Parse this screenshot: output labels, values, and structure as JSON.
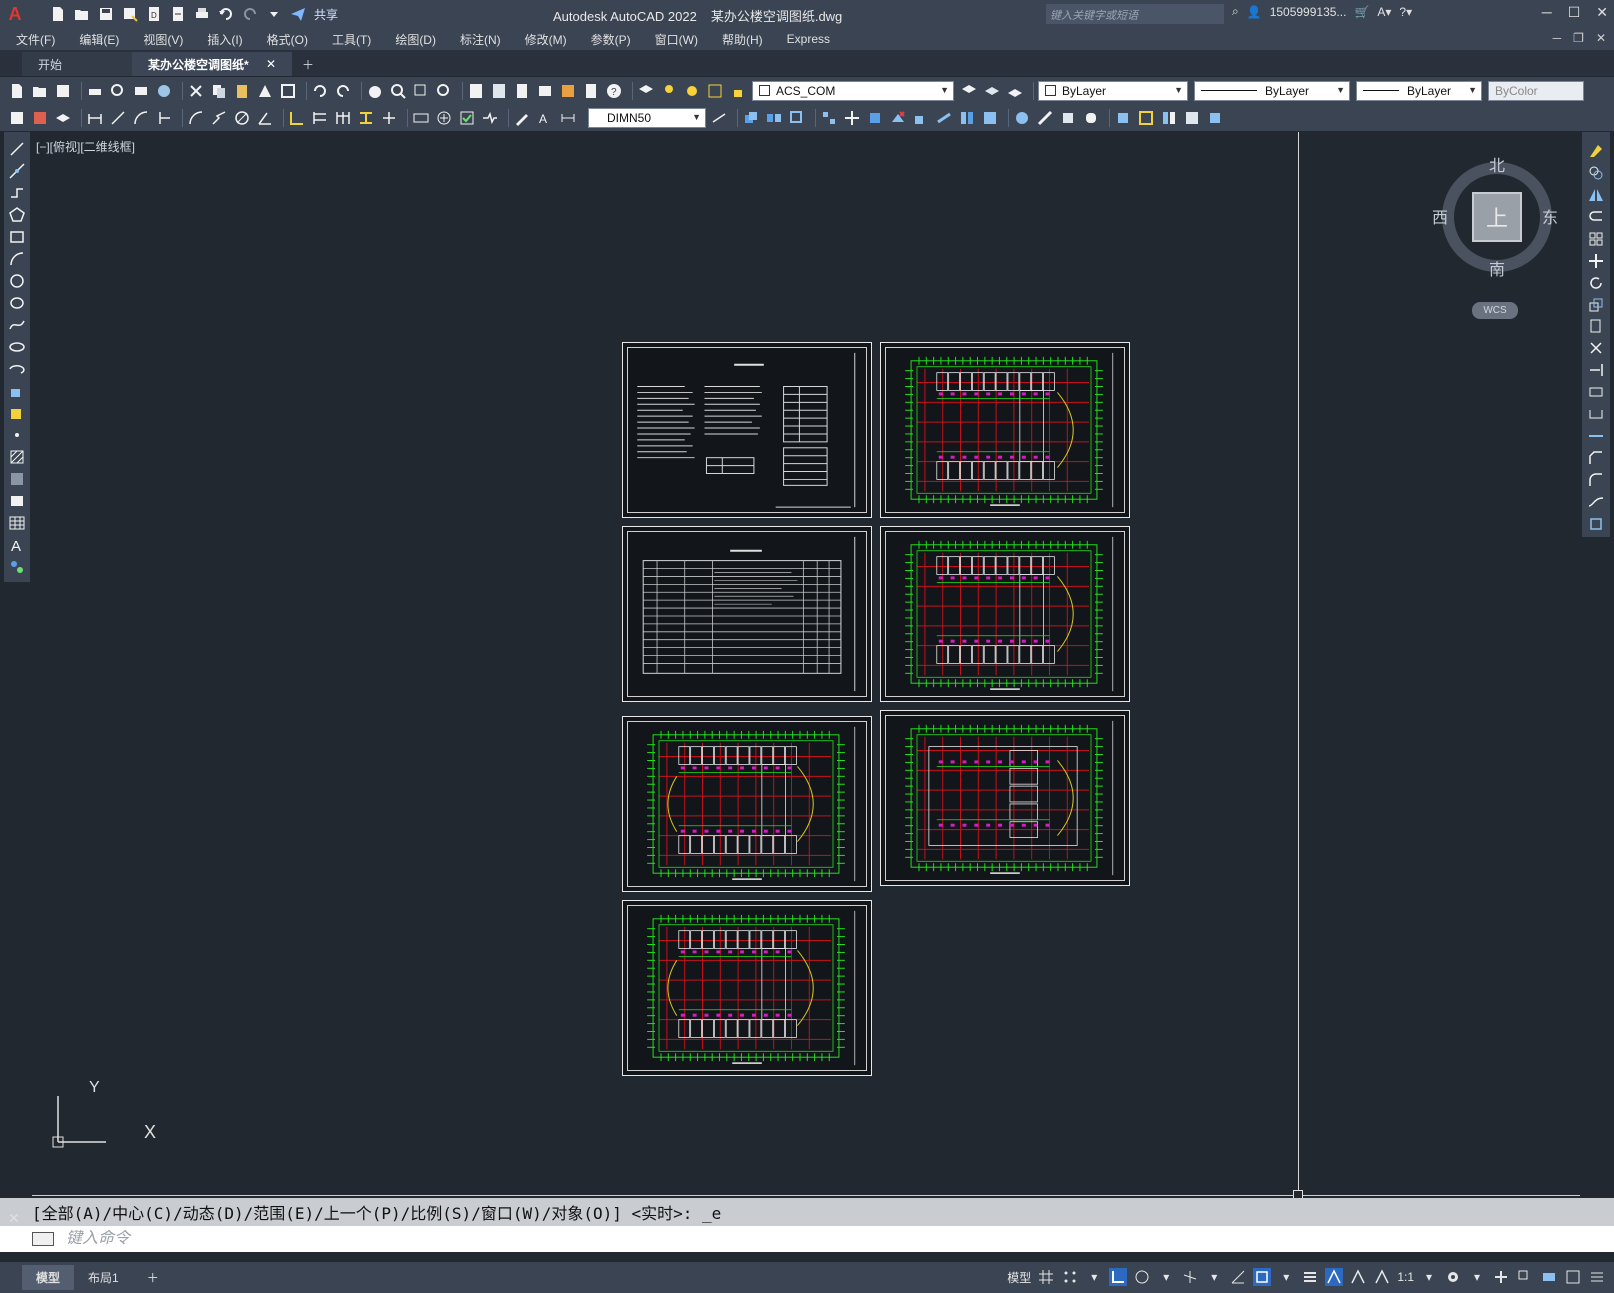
{
  "app": {
    "title": "Autodesk AutoCAD 2022",
    "filename": "某办公楼空调图纸.dwg",
    "share_label": "共享",
    "search_placeholder": "键入关键字或短语",
    "user": "1505999135...",
    "logo_letter": "A"
  },
  "menu": [
    "文件(F)",
    "编辑(E)",
    "视图(V)",
    "插入(I)",
    "格式(O)",
    "工具(T)",
    "绘图(D)",
    "标注(N)",
    "修改(M)",
    "参数(P)",
    "窗口(W)",
    "帮助(H)",
    "Express"
  ],
  "tabs": {
    "start": "开始",
    "active": "某办公楼空调图纸*"
  },
  "toolbar": {
    "layer_value": "ACS_COM",
    "color_value": "ByLayer",
    "linetype_value": "ByLayer",
    "lineweight_value": "ByLayer",
    "plotstyle_value": "ByColor",
    "dimstyle_value": "DIMN50"
  },
  "viewport": {
    "label": "[−][俯视][二维线框]"
  },
  "viewcube": {
    "north": "北",
    "south": "南",
    "east": "东",
    "west": "西",
    "face": "上",
    "wcs": "WCS"
  },
  "ucs": {
    "y": "Y",
    "x": "X"
  },
  "command": {
    "history": "[全部(A)/中心(C)/动态(D)/范围(E)/上一个(P)/比例(S)/窗口(W)/对象(O)] <实时>: _e",
    "placeholder": "键入命令"
  },
  "status": {
    "model_tab": "模型",
    "layout_tab": "布局1",
    "model_label": "模型",
    "scale": "1:1"
  },
  "colors": {
    "plan_green": "#22e01a",
    "plan_red": "#c4121a",
    "plan_magenta": "#d020c0",
    "plan_yellow": "#d8c820",
    "canvas": "#212830"
  }
}
